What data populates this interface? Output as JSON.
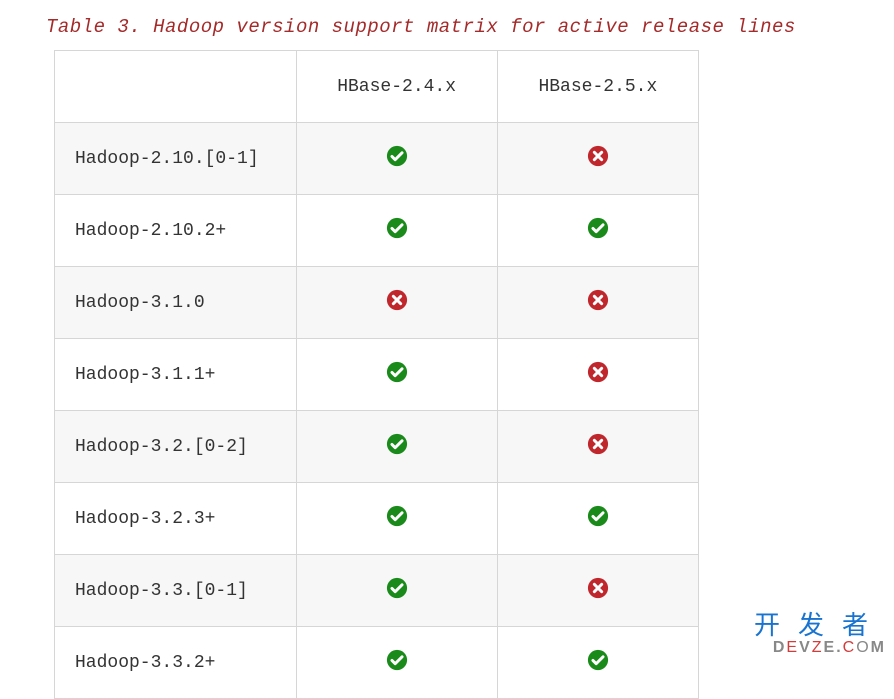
{
  "caption": "Table 3. Hadoop version support matrix for active release lines",
  "headers": {
    "col0": "",
    "col1": "HBase-2.4.x",
    "col2": "HBase-2.5.x"
  },
  "rows": [
    {
      "label": "Hadoop-2.10.[0-1]",
      "c1": "yes",
      "c2": "no"
    },
    {
      "label": "Hadoop-2.10.2+",
      "c1": "yes",
      "c2": "yes"
    },
    {
      "label": "Hadoop-3.1.0",
      "c1": "no",
      "c2": "no"
    },
    {
      "label": "Hadoop-3.1.1+",
      "c1": "yes",
      "c2": "no"
    },
    {
      "label": "Hadoop-3.2.[0-2]",
      "c1": "yes",
      "c2": "no"
    },
    {
      "label": "Hadoop-3.2.3+",
      "c1": "yes",
      "c2": "yes"
    },
    {
      "label": "Hadoop-3.3.[0-1]",
      "c1": "yes",
      "c2": "no"
    },
    {
      "label": "Hadoop-3.3.2+",
      "c1": "yes",
      "c2": "yes"
    }
  ],
  "watermark": {
    "zh": "开发者",
    "en_pre": "D",
    "en_mid1": "E",
    "en_mid2": "V",
    "en_z": "Z",
    "en_e2": "E",
    "en_dot": ".",
    "en_c": "C",
    "en_o": "O",
    "en_m": "M"
  },
  "icons": {
    "yes": "check-circle-icon",
    "no": "x-circle-icon"
  },
  "colors": {
    "yes": "#1a8a1a",
    "no": "#c0272d"
  }
}
